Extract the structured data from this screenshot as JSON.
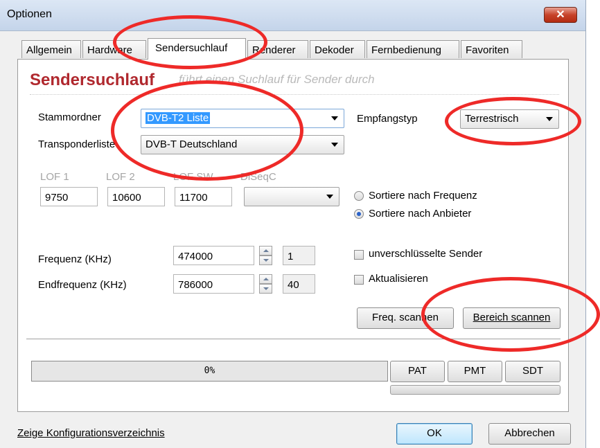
{
  "window": {
    "title": "Optionen",
    "close_glyph": "✕"
  },
  "tabs": [
    {
      "label": "Allgemein"
    },
    {
      "label": "Hardware"
    },
    {
      "label": "Sendersuchlauf",
      "active": true
    },
    {
      "label": "Renderer"
    },
    {
      "label": "Dekoder"
    },
    {
      "label": "Fernbedienung"
    },
    {
      "label": "Favoriten"
    }
  ],
  "page": {
    "heading": "Sendersuchlauf",
    "subheading": "führt einen Suchlauf für Sender durch"
  },
  "form": {
    "stammordner": {
      "label": "Stammordner",
      "value": "DVB-T2 Liste"
    },
    "transponderliste": {
      "label": "Transponderliste",
      "value": "DVB-T Deutschland"
    },
    "empfangstyp": {
      "label": "Empfangstyp",
      "value": "Terrestrisch"
    },
    "lof1": {
      "label": "LOF 1",
      "value": "9750"
    },
    "lof2": {
      "label": "LOF 2",
      "value": "10600"
    },
    "lofsw": {
      "label": "LOF SW",
      "value": "11700"
    },
    "diseqc": {
      "label": "DiSeqC",
      "value": ""
    },
    "sort_freq": {
      "label": "Sortiere nach Frequenz",
      "checked": false
    },
    "sort_anbieter": {
      "label": "Sortiere nach Anbieter",
      "checked": true
    },
    "frequenz": {
      "label": "Frequenz (KHz)",
      "value": "474000",
      "step": "1"
    },
    "endfrequenz": {
      "label": "Endfrequenz (KHz)",
      "value": "786000",
      "step": "40"
    },
    "unverschluesselt": {
      "label": "unverschlüsselte Sender",
      "checked": false
    },
    "aktualisieren": {
      "label": "Aktualisieren",
      "checked": false
    }
  },
  "buttons": {
    "freq_scan": "Freq. scannen",
    "range_scan": "Bereich scannen",
    "pat": "PAT",
    "pmt": "PMT",
    "sdt": "SDT",
    "ok": "OK",
    "cancel": "Abbrechen"
  },
  "progress": {
    "value": 0,
    "label": "0%"
  },
  "footer": {
    "link": "Zeige Konfigurationsverzeichnis"
  },
  "colors": {
    "heading": "#b0282e",
    "annotation": "#ee2a28",
    "selection": "#3399ff"
  }
}
